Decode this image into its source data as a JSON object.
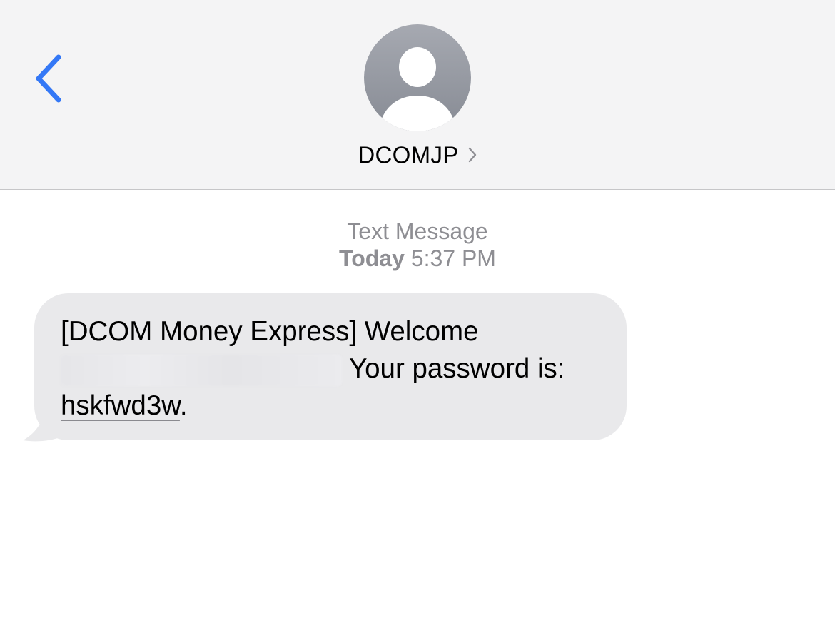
{
  "header": {
    "back_icon": "chevron-left-icon",
    "avatar_icon": "person-silhouette-icon",
    "contact_name": "DCOMJP",
    "contact_chevron_icon": "chevron-right-icon",
    "accent_color": "#3478f6"
  },
  "thread": {
    "service_label": "Text Message",
    "day_label": "Today",
    "time_label": "5:37 PM"
  },
  "message": {
    "line1": "[DCOM Money Express] Welcome",
    "line2": "Your password is:",
    "password": "hskfwd3w",
    "trailing": ".",
    "bubble_color": "#e9e9eb"
  }
}
